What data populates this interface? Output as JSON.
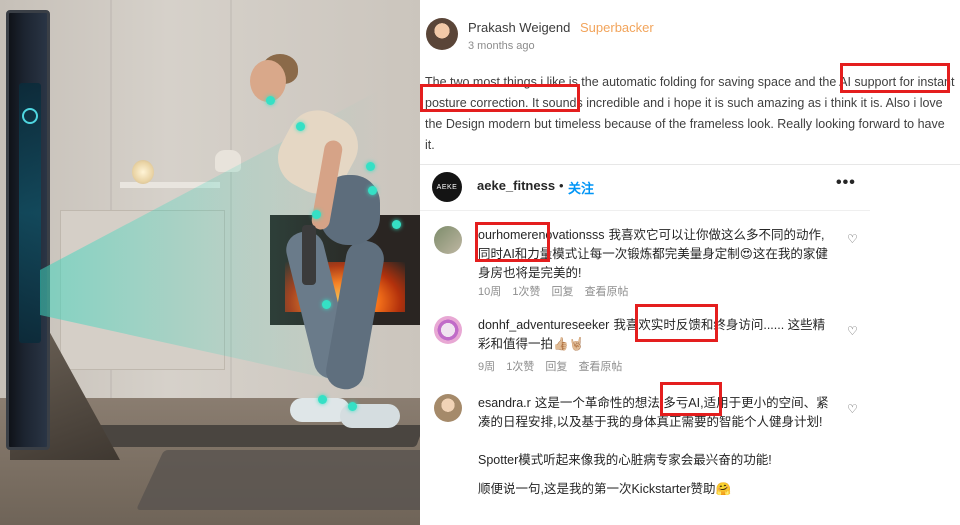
{
  "post": {
    "author": "Prakash Weigend",
    "badge": "Superbacker",
    "time": "3 months ago",
    "body": "The two most things i like is the automatic folding for saving space and the AI support for instant posture correction. It sounds incredible and i hope it is such amazing as i think it is. Also i love the Design modern but timeless because of the frameless look. Really looking forward to have it."
  },
  "instagram": {
    "username": "aeke_fitness",
    "avatar_text": "AEKE",
    "dot": "•",
    "follow_label": "关注",
    "more_label": "•••",
    "comments": [
      {
        "user": "ourhomerenovationsss",
        "text": "我喜欢它可以让你做这么多不同的动作,同时AI和力量模式让每一次锻炼都完美量身定制😍这在我的家健身房也将是完美的!",
        "time": "10周",
        "likes": "1次赞",
        "reply": "回复",
        "translate": "查看原帖",
        "heart": "♡"
      },
      {
        "user": "donhf_adventureseeker",
        "text": "我喜欢实时反馈和终身访问...... 这些精彩和值得一拍👍🏼🤘🏼",
        "time": "9周",
        "likes": "1次赞",
        "reply": "回复",
        "translate": "查看原帖",
        "heart": "♡"
      },
      {
        "user": "esandra.r",
        "text": "这是一个革命性的想法,多亏AI,适用于更小的空间、紧凑的日程安排,以及基于我的身体真正需要的智能个人健身计划!",
        "text2": "Spotter模式听起来像我的心脏病专家会最兴奋的功能!",
        "text3": "顺便说一句,这是我的第一次Kickstarter赞助🤗",
        "heart": "♡"
      }
    ]
  },
  "colors": {
    "highlight": "#e41e1e",
    "superbacker": "#f2a45b",
    "follow": "#0095f6",
    "pose_overlay": "#35e0c5"
  },
  "icons": [
    "heart-icon",
    "more-options-icon"
  ]
}
